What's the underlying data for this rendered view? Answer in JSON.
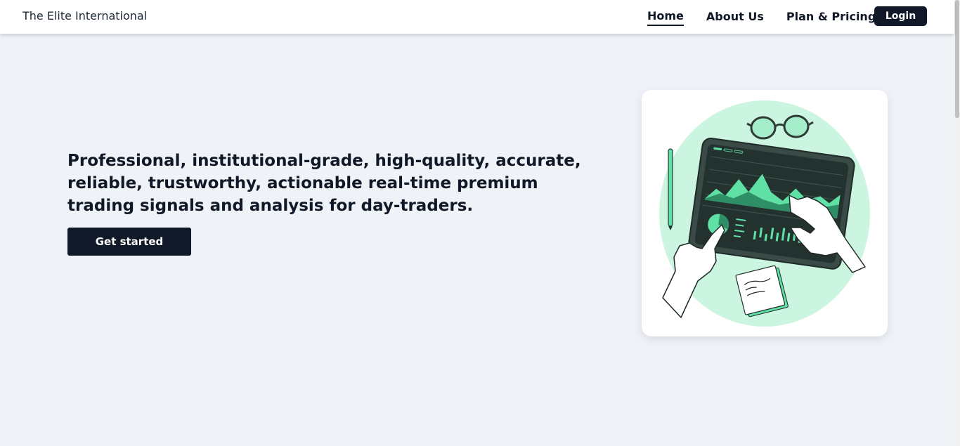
{
  "navbar": {
    "brand": "The Elite International",
    "links": [
      {
        "label": "Home",
        "active": true
      },
      {
        "label": "About Us",
        "active": false
      },
      {
        "label": "Plan & Pricing",
        "active": false
      }
    ],
    "login_label": "Login"
  },
  "hero": {
    "headline": "Professional, institutional-grade, high-quality, accurate, reliable, trustworthy, actionable real-time premium trading signals and analysis for day-traders.",
    "cta_label": "Get started"
  },
  "colors": {
    "primary": "#111827",
    "background": "#eff3f8",
    "accent_green": "#5fe0a4",
    "accent_mint": "#cbf5e0"
  }
}
